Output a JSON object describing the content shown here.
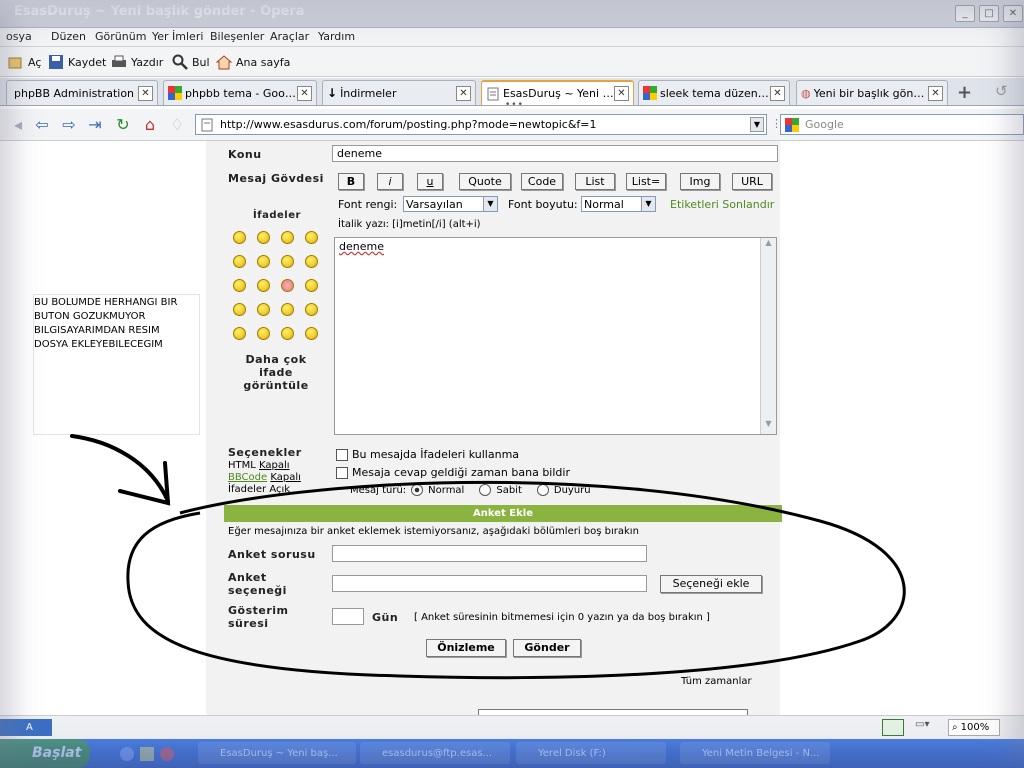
{
  "window": {
    "title": "EsasDuruş ~ Yeni başlık gönder - Opera"
  },
  "menu": [
    "osya",
    "Düzen",
    "Görünüm",
    "Yer İmleri",
    "Bileşenler",
    "Araçlar",
    "Yardım"
  ],
  "toolbar": {
    "open": "Aç",
    "save": "Kaydet",
    "print": "Yazdır",
    "find": "Bul",
    "home": "Ana sayfa"
  },
  "tabs": [
    {
      "label": "phpBB Administration"
    },
    {
      "label": "phpbb tema - Googl..."
    },
    {
      "label": "İndirmeler"
    },
    {
      "label": "EsasDuruş ~ Yeni b..."
    },
    {
      "label": "sleek tema düzenle..."
    },
    {
      "label": "Yeni bir başlık gönder"
    }
  ],
  "address": {
    "url": "http://www.esasdurus.com/forum/posting.php?mode=newtopic&f=1",
    "search_placeholder": "Google"
  },
  "note": {
    "lines": [
      "BU BOLUMDE HERHANGI BIR",
      "BUTON GOZUKMUYOR",
      "BILGISAYARIMDAN RESIM",
      "DOSYA EKLEYEBILECEGIM"
    ]
  },
  "form": {
    "subject_label": "Konu",
    "subject_value": "deneme",
    "body_label": "Mesaj Gövdesi",
    "smilies_label": "İfadeler",
    "more_smilies": "Daha çok ifade görüntüle",
    "bbcode_buttons": [
      "B",
      "i",
      "u",
      "Quote",
      "Code",
      "List",
      "List=",
      "Img",
      "URL"
    ],
    "font_color_label": "Font rengi:",
    "font_color_value": "Varsayılan",
    "font_size_label": "Font boyutu:",
    "font_size_value": "Normal",
    "close_tags": "Etiketleri Sonlandır",
    "help_text": "İtalik yazı: [i]metin[/i]  (alt+i)",
    "message_value": "deneme",
    "options_label": "Seçenekler",
    "html_label": "HTML",
    "html_state": "Kapalı",
    "bbcode_label": "BBCode",
    "bbcode_state": "Kapalı",
    "smilies_state_label": "İfadeler",
    "smilies_state": "Açık",
    "opt_disable_smilies": "Bu mesajda İfadeleri kullanma",
    "opt_notify": "Mesaja cevap geldiği zaman bana bildir",
    "post_type_label": "Mesaj türü:",
    "post_types": [
      "Normal",
      "Sabit",
      "Duyuru"
    ],
    "poll_header": "Anket Ekle",
    "poll_hint": "Eğer mesajınıza bir anket eklemek istemiyorsanız, aşağıdaki bölümleri boş bırakın",
    "poll_question_label": "Anket sorusu",
    "poll_option_label": "Anket seçeneği",
    "add_option_button": "Seçeneği ekle",
    "poll_length_label": "Gösterim süresi",
    "days_label": "Gün",
    "poll_length_hint": "[ Anket süresinin bitmemesi için 0 yazın ya da boş bırakın ]",
    "preview_button": "Önizleme",
    "submit_button": "Gönder",
    "timezone_text": "Tüm zamanlar"
  },
  "status": {
    "zoom": "100%",
    "left_label": "A"
  },
  "taskbar": {
    "start": "Başlat",
    "items": [
      "EsasDuruş ~ Yeni baş...",
      "esasdurus@ftp.esas...",
      "Yerel Disk (F:)",
      "Yeni Metin Belgesi - N..."
    ]
  },
  "colors": {
    "accent_green": "#8ab33f",
    "link_green": "#4d8a1f",
    "tab_active_border": "#e6a43e"
  }
}
